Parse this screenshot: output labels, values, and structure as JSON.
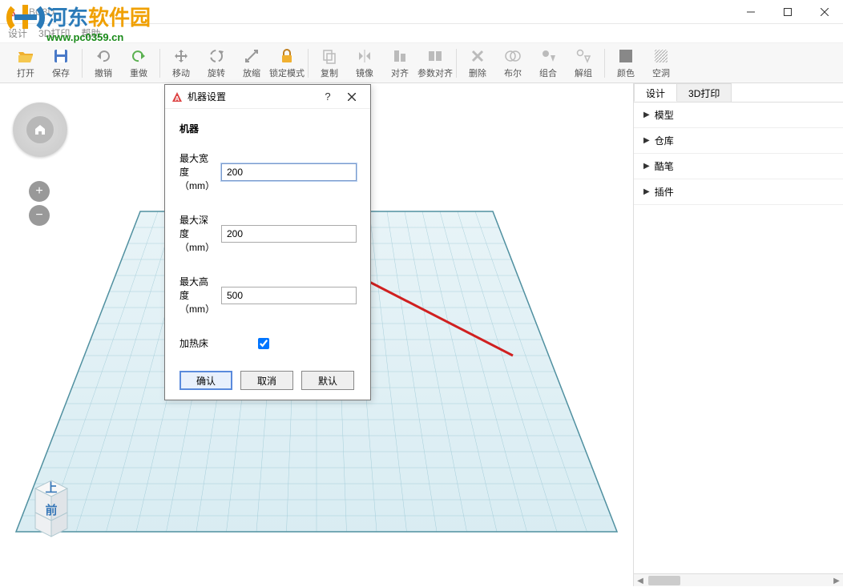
{
  "window": {
    "title": "ABC3D"
  },
  "menubar": {
    "items": [
      "设计",
      "3D打印",
      "帮助"
    ]
  },
  "toolbar": {
    "open": "打开",
    "save": "保存",
    "undo": "撤销",
    "redo": "重做",
    "move": "移动",
    "rotate": "旋转",
    "scale": "放缩",
    "lock": "锁定模式",
    "copy": "复制",
    "mirror": "镜像",
    "align": "对齐",
    "paramalign": "参数对齐",
    "delete": "删除",
    "boolean": "布尔",
    "group": "组合",
    "ungroup": "解组",
    "color": "颜色",
    "hole": "空洞"
  },
  "sidebar": {
    "tabs": {
      "design": "设计",
      "print": "3D打印"
    },
    "panels": {
      "model": "模型",
      "warehouse": "仓库",
      "coolpen": "酷笔",
      "plugin": "插件"
    }
  },
  "viewcube": {
    "top": "上",
    "front": "前"
  },
  "dialog": {
    "title": "机器设置",
    "section": "机器",
    "maxwidth_label": "最大宽度（mm）",
    "maxwidth_value": "200",
    "maxdepth_label": "最大深度（mm）",
    "maxdepth_value": "200",
    "maxheight_label": "最大高度（mm）",
    "maxheight_value": "500",
    "heatedbed_label": "加热床",
    "ok": "确认",
    "cancel": "取消",
    "default": "默认"
  },
  "watermark": {
    "brand": "河东软件园",
    "url": "www.pc0359.cn"
  }
}
